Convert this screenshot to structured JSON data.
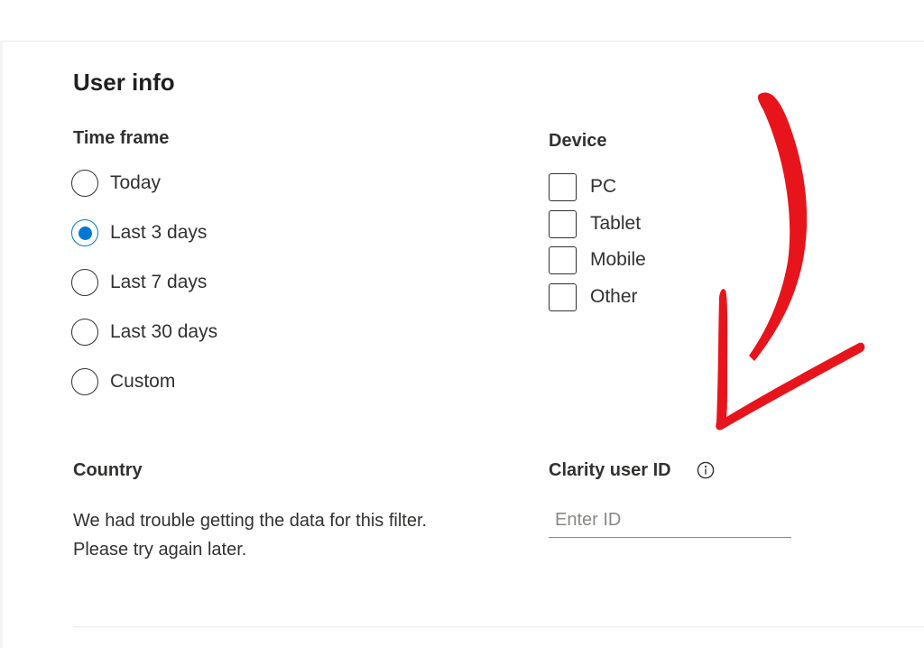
{
  "user_info": {
    "title": "User info",
    "time_frame": {
      "label": "Time frame",
      "options": [
        "Today",
        "Last 3 days",
        "Last 7 days",
        "Last 30 days",
        "Custom"
      ],
      "selected": "Last 3 days"
    },
    "device": {
      "label": "Device",
      "options": [
        "PC",
        "Tablet",
        "Mobile",
        "Other"
      ]
    },
    "country": {
      "label": "Country",
      "message": "We had trouble getting the data for this filter. Please try again later."
    },
    "clarity_user_id": {
      "label": "Clarity user ID",
      "info_icon": "info-icon",
      "placeholder": "Enter ID",
      "value": ""
    }
  },
  "annotation": {
    "icon": "red-arrow",
    "color": "#e8141b"
  },
  "colors": {
    "accent": "#0078d4",
    "text": "#323130"
  }
}
